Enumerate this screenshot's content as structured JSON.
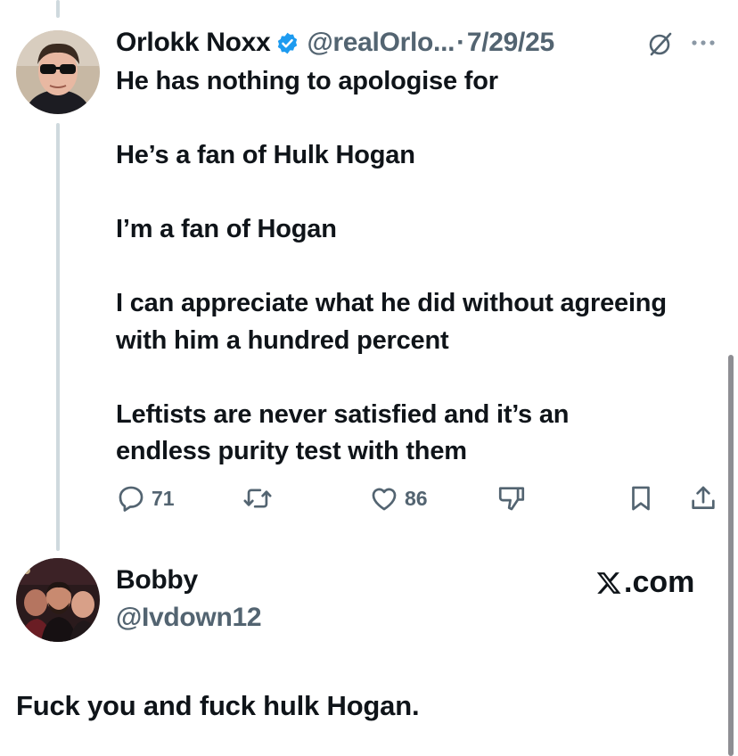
{
  "tweet": {
    "author_name": "Orlokk Noxx",
    "handle": "@realOrlo...",
    "separator": "·",
    "date": "7/29/25",
    "paragraphs": [
      "He has nothing to apologise for",
      "He’s a fan of Hulk Hogan",
      "I’m a fan of Hogan",
      "I can appreciate what he did without agreeing with him a hundred percent",
      "Leftists are never satisfied and it’s an endless purity test with them"
    ],
    "actions": {
      "replies": "71",
      "likes": "86"
    }
  },
  "reply": {
    "author_name": "Bobby",
    "handle": "@Ivdown12",
    "text": "Fuck you and fuck hulk Hogan."
  },
  "watermark": {
    "text": ".com"
  },
  "colors": {
    "text": "#0f1419",
    "muted": "#536471",
    "verified_blue": "#1d9bf0",
    "thread_line": "#cfd9de"
  },
  "icons": {
    "verified": "verified-badge-icon",
    "grok": "grok-icon",
    "more": "more-icon",
    "reply": "reply-icon",
    "retweet": "retweet-icon",
    "like": "heart-icon",
    "dislike": "dislike-icon",
    "bookmark": "bookmark-icon",
    "share": "share-icon",
    "x_logo": "x-logo-icon"
  }
}
